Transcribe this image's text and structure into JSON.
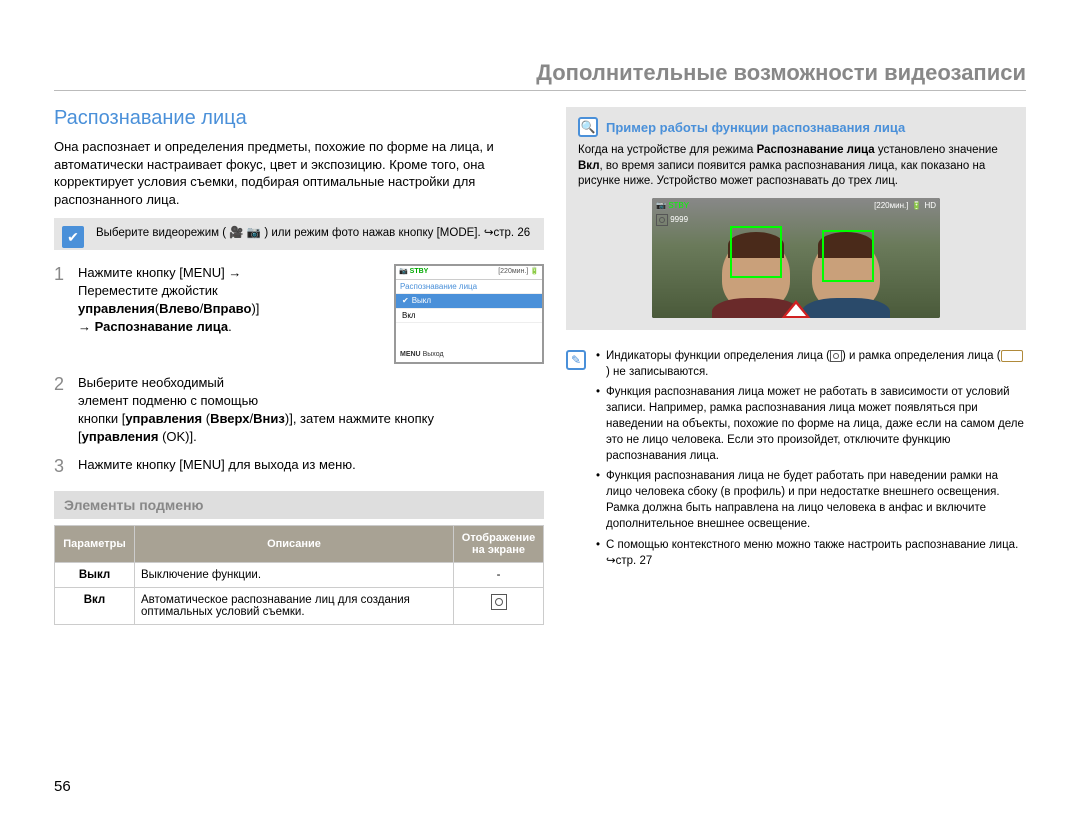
{
  "header": {
    "title": "Дополнительные возможности видеозаписи"
  },
  "section_title": "Распознавание лица",
  "intro": "Она распознает и определения предметы, похожие по форме на лица, и автоматически настраивает фокус, цвет и экспозицию. Кроме того, она корректирует условия съемки, подбирая оптимальные настройки для распознанного лица.",
  "mode_tip": {
    "before": "Выберите видеорежим (",
    "after": ") или режим фото нажав кнопку [MODE]. ↪стр. 26"
  },
  "steps": {
    "s1": {
      "num": "1",
      "l1": "Нажмите кнопку [MENU] →",
      "l2": "Переместите джойстик",
      "l3a": "управления",
      "l3b": "(",
      "l3c": "Влево",
      "l3d": "/",
      "l3e": "Вправо",
      "l3f": ")]",
      "l4": "→ Распознавание лица",
      "l4dot": "."
    },
    "s2": {
      "num": "2",
      "l1": "Выберите необходимый",
      "l2": "элемент подменю с помощью",
      "l3a": "кнопки [",
      "l3b": "управления",
      "l3c": " (",
      "l3d": "Вверх",
      "l3e": "/",
      "l3f": "Вниз",
      "l3g": ")], затем нажмите кнопку",
      "l4": "[",
      "l4b": "управления",
      "l4c": " (OK)]."
    },
    "s3": {
      "num": "3",
      "text": "Нажмите кнопку [MENU] для выхода из меню."
    }
  },
  "mini": {
    "stby": "STBY",
    "time": "[220мин.]",
    "title": "Распознавание лица",
    "off_mark": "✔",
    "off": "Выкл",
    "on": "Вкл",
    "menu": "MENU",
    "exit": "Выход"
  },
  "sub_heading": "Элементы подменю",
  "table": {
    "h1": "Параметры",
    "h2": "Описание",
    "h3": "Отображение на экране",
    "r1p": "Выкл",
    "r1d": "Выключение функции.",
    "r1s": "-",
    "r2p": "Вкл",
    "r2d": "Автоматическое распознавание лиц для создания оптимальных условий съемки."
  },
  "example": {
    "title": "Пример работы функции распознавания лица",
    "p1a": "Когда на устройстве для режима ",
    "p1b": "Распознавание лица",
    "p2a": " установлено значение ",
    "p2b": "Вкл",
    "p2c": ", во время записи появится рамка распознавания лица, как показано на рисунке ниже. Устройство может распознавать до трех лиц.",
    "overlay_stby": "STBY",
    "overlay_time": "[220мин.]",
    "overlay_hd": "HD",
    "overlay_count": "9999"
  },
  "notes": {
    "n1a": "Индикаторы функции определения лица (",
    "n1b": ") и рамка определения лица (",
    "n1c": ") не записываются.",
    "n2": "Функция распознавания лица может не работать в зависимости от условий записи. Например, рамка распознавания лица может появляться при наведении на объекты, похожие по форме на лица, даже если на самом деле это не лицо человека. Если это произойдет, отключите функцию распознавания лица.",
    "n3": "Функция распознавания лица не будет работать при наведении рамки на лицо человека сбоку (в профиль) и при недостатке внешнего освещения. Рамка должна быть направлена на лицо человека в анфас и включите дополнительное внешнее освещение.",
    "n4": "С помощью контекстного меню можно также настроить распознавание лица. ↪стр. 27"
  },
  "page_num": "56"
}
